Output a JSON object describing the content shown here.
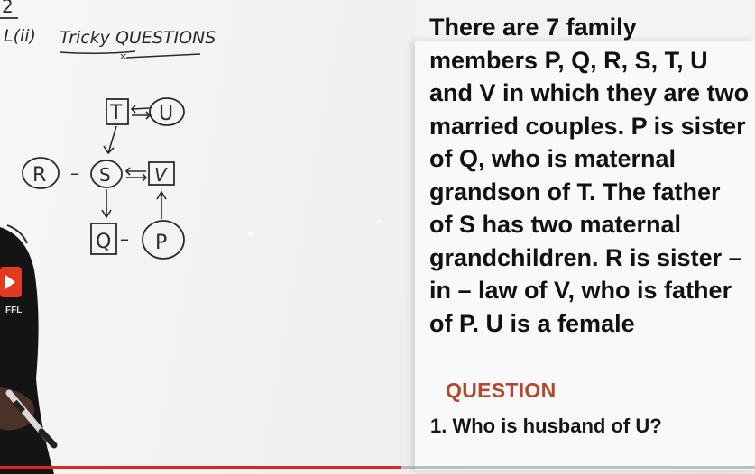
{
  "board": {
    "header_number": "2",
    "header_label": "L(ii)",
    "header_title": "Tricky QUESTIONS",
    "diagram_nodes": {
      "t": "T",
      "u": "U",
      "r": "R",
      "s": "S",
      "v": "V",
      "q": "Q",
      "p": "P"
    },
    "dash": "–"
  },
  "presenter": {
    "logo_text": "FFL"
  },
  "panel": {
    "question_text": "There are 7 family members P, Q, R, S, T, U and V in which they are two married couples. P is sister of Q, who is maternal grandson of T. The father of S has two maternal grandchildren. R is sister – in – law of V, who is father of P. U is a female",
    "heading": "QUESTION",
    "item": "1. Who is husband of U?"
  },
  "video": {
    "progress": 0.53
  },
  "colors": {
    "heading": "#b5472a",
    "progress": "#e0251b",
    "ink": "#2a2a2a"
  }
}
